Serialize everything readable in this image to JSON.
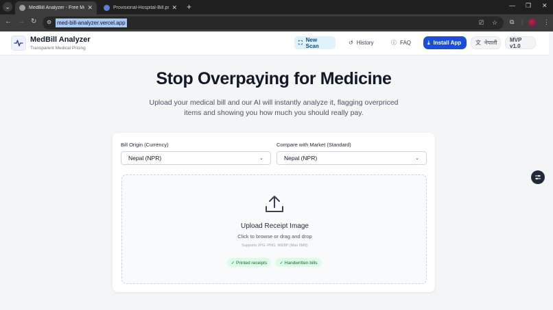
{
  "browser": {
    "tabs": [
      {
        "title": "MedBill Analyzer - Free Medica",
        "active": true
      },
      {
        "title": "Provisional-Hospital-Bill.png (3",
        "active": false
      }
    ],
    "url": "med-bill-analyzer.vercel.app"
  },
  "header": {
    "brand_name": "MedBill Analyzer",
    "brand_tagline": "Transparent Medical Pricing",
    "nav": {
      "new_scan": "New Scan",
      "history": "History",
      "faq": "FAQ",
      "install": "Install App",
      "language": "नेपाली",
      "version": "MVP v1.0"
    }
  },
  "hero": {
    "title": "Stop Overpaying for Medicine",
    "subtitle": "Upload your medical bill and our AI will instantly analyze it, flagging overpriced items and showing you how much you should really pay."
  },
  "form": {
    "origin_label": "Bill Origin (Currency)",
    "origin_value": "Nepal (NPR)",
    "market_label": "Compare with Market (Standard)",
    "market_value": "Nepal (NPR)"
  },
  "upload": {
    "title": "Upload Receipt Image",
    "subtitle": "Click to browse or drag and drop",
    "note": "Supports JPG, PNG, WEBP (Max 5MB)",
    "chips": [
      "✓ Printed receipts",
      "✓ Handwritten bills"
    ]
  },
  "colors": {
    "accent": "#1d4ed8",
    "chip_bg": "#dcfce7",
    "chip_text": "#166534"
  }
}
